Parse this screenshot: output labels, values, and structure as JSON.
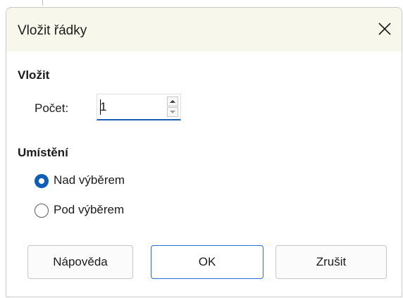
{
  "dialog": {
    "title": "Vložit řádky",
    "close_icon": "close-icon"
  },
  "insert": {
    "heading": "Vložit",
    "count_label": "Počet:",
    "count_value": "1"
  },
  "position": {
    "heading": "Umístění",
    "options": [
      {
        "label": "Nad výběrem",
        "selected": true
      },
      {
        "label": "Pod výběrem",
        "selected": false
      }
    ]
  },
  "buttons": {
    "help": "Nápověda",
    "ok": "OK",
    "cancel": "Zrušit"
  },
  "colors": {
    "title_bar": "#f7f7ec",
    "accent": "#0f5fb8"
  }
}
